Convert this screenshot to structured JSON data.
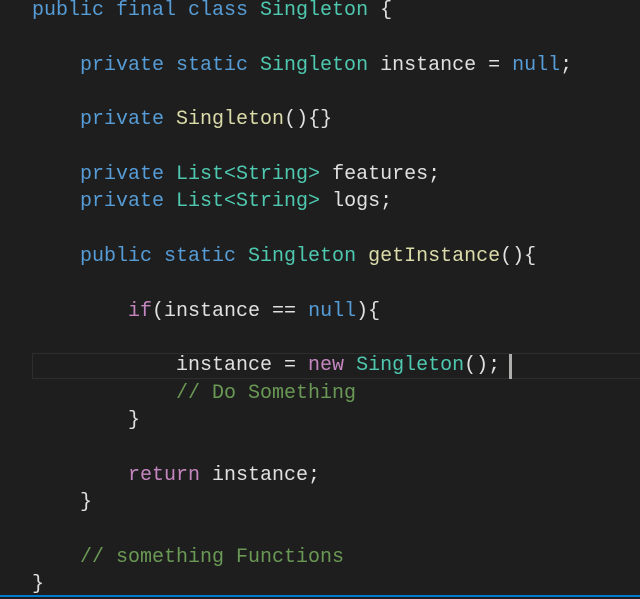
{
  "editor": {
    "colors": {
      "background": "#1e1e1e",
      "keyword": "#569cd6",
      "type": "#4ec9b0",
      "function": "#dcdcaa",
      "control": "#c586c0",
      "comment": "#6a9955",
      "status_bar": "#007acc"
    },
    "current_line": 13,
    "lines": [
      [
        [
          "public final class ",
          "keyword"
        ],
        [
          "Singleton",
          "type"
        ],
        [
          " {",
          "plain"
        ]
      ],
      [],
      [
        [
          "    private static ",
          "keyword"
        ],
        [
          "Singleton",
          "type"
        ],
        [
          " instance = ",
          "plain"
        ],
        [
          "null",
          "keyword"
        ],
        [
          ";",
          "plain"
        ]
      ],
      [],
      [
        [
          "    private ",
          "keyword"
        ],
        [
          "Singleton",
          "func"
        ],
        [
          "(){}",
          "plain"
        ]
      ],
      [],
      [
        [
          "    private ",
          "keyword"
        ],
        [
          "List<String>",
          "type"
        ],
        [
          " features;",
          "plain"
        ]
      ],
      [
        [
          "    private ",
          "keyword"
        ],
        [
          "List<String>",
          "type"
        ],
        [
          " logs;",
          "plain"
        ]
      ],
      [],
      [
        [
          "    public static ",
          "keyword"
        ],
        [
          "Singleton",
          "type"
        ],
        [
          " ",
          "plain"
        ],
        [
          "getInstance",
          "func"
        ],
        [
          "(){",
          "plain"
        ]
      ],
      [],
      [
        [
          "        if",
          "control"
        ],
        [
          "(instance == ",
          "plain"
        ],
        [
          "null",
          "keyword"
        ],
        [
          "){",
          "plain"
        ]
      ],
      [],
      [
        [
          "            instance = ",
          "plain"
        ],
        [
          "new",
          "control"
        ],
        [
          " ",
          "plain"
        ],
        [
          "Singleton",
          "type"
        ],
        [
          "();",
          "plain"
        ]
      ],
      [
        [
          "            // Do Something",
          "comment"
        ]
      ],
      [
        [
          "        }",
          "plain"
        ]
      ],
      [],
      [
        [
          "        return",
          "control"
        ],
        [
          " instance;",
          "plain"
        ]
      ],
      [
        [
          "    }",
          "plain"
        ]
      ],
      [],
      [
        [
          "    // something Functions",
          "comment"
        ]
      ],
      [
        [
          "}",
          "plain"
        ]
      ]
    ]
  }
}
